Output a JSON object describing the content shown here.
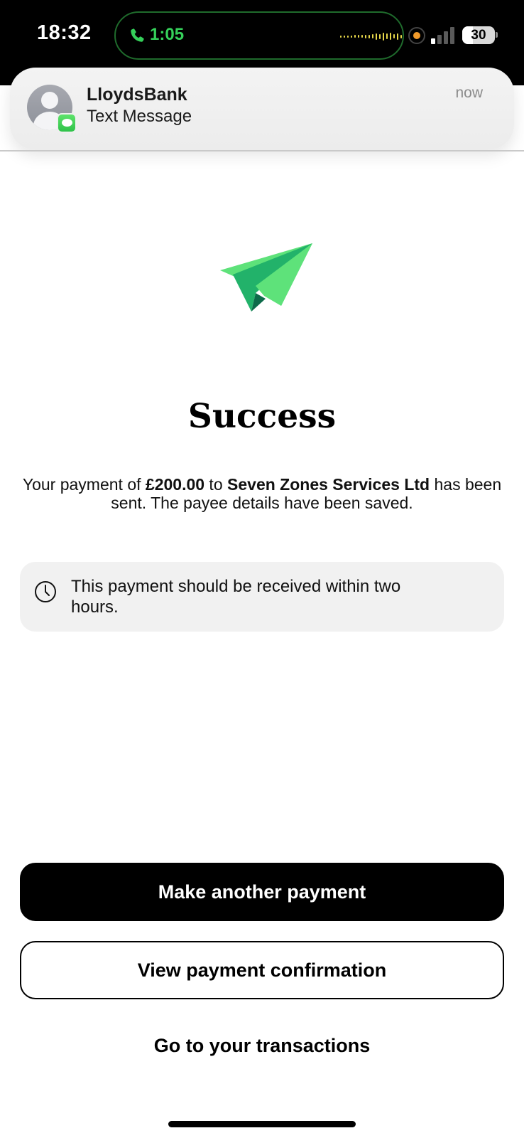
{
  "status_bar": {
    "time": "18:32",
    "call_timer": "1:05",
    "battery": "30",
    "icons": [
      "phone-icon",
      "audio-wave-icon",
      "recording-dot-icon",
      "cellular-signal-icon",
      "battery-icon"
    ]
  },
  "notification": {
    "sender": "LloydsBank",
    "subtitle": "Text Message",
    "time": "now",
    "icons": [
      "contact-avatar-icon",
      "messages-app-icon"
    ]
  },
  "main": {
    "icon": "paper-plane-icon",
    "title": "Success",
    "message": {
      "part1": "Your payment of ",
      "amount": "£200.00",
      "part2": " to ",
      "payee": "Seven Zones Services Ltd",
      "part3": " has been sent. The payee details have been saved."
    },
    "info_box": {
      "icon": "clock-icon",
      "text": "This payment should be received within two hours."
    }
  },
  "actions": {
    "primary": "Make another payment",
    "secondary": "View payment confirmation",
    "link": "Go to your transactions"
  },
  "colors": {
    "plane_light": "#5ee27a",
    "plane_mid": "#22b26a",
    "plane_dark": "#0d6b4a",
    "call_green": "#35d05a",
    "info_bg": "#f1f1f1"
  }
}
